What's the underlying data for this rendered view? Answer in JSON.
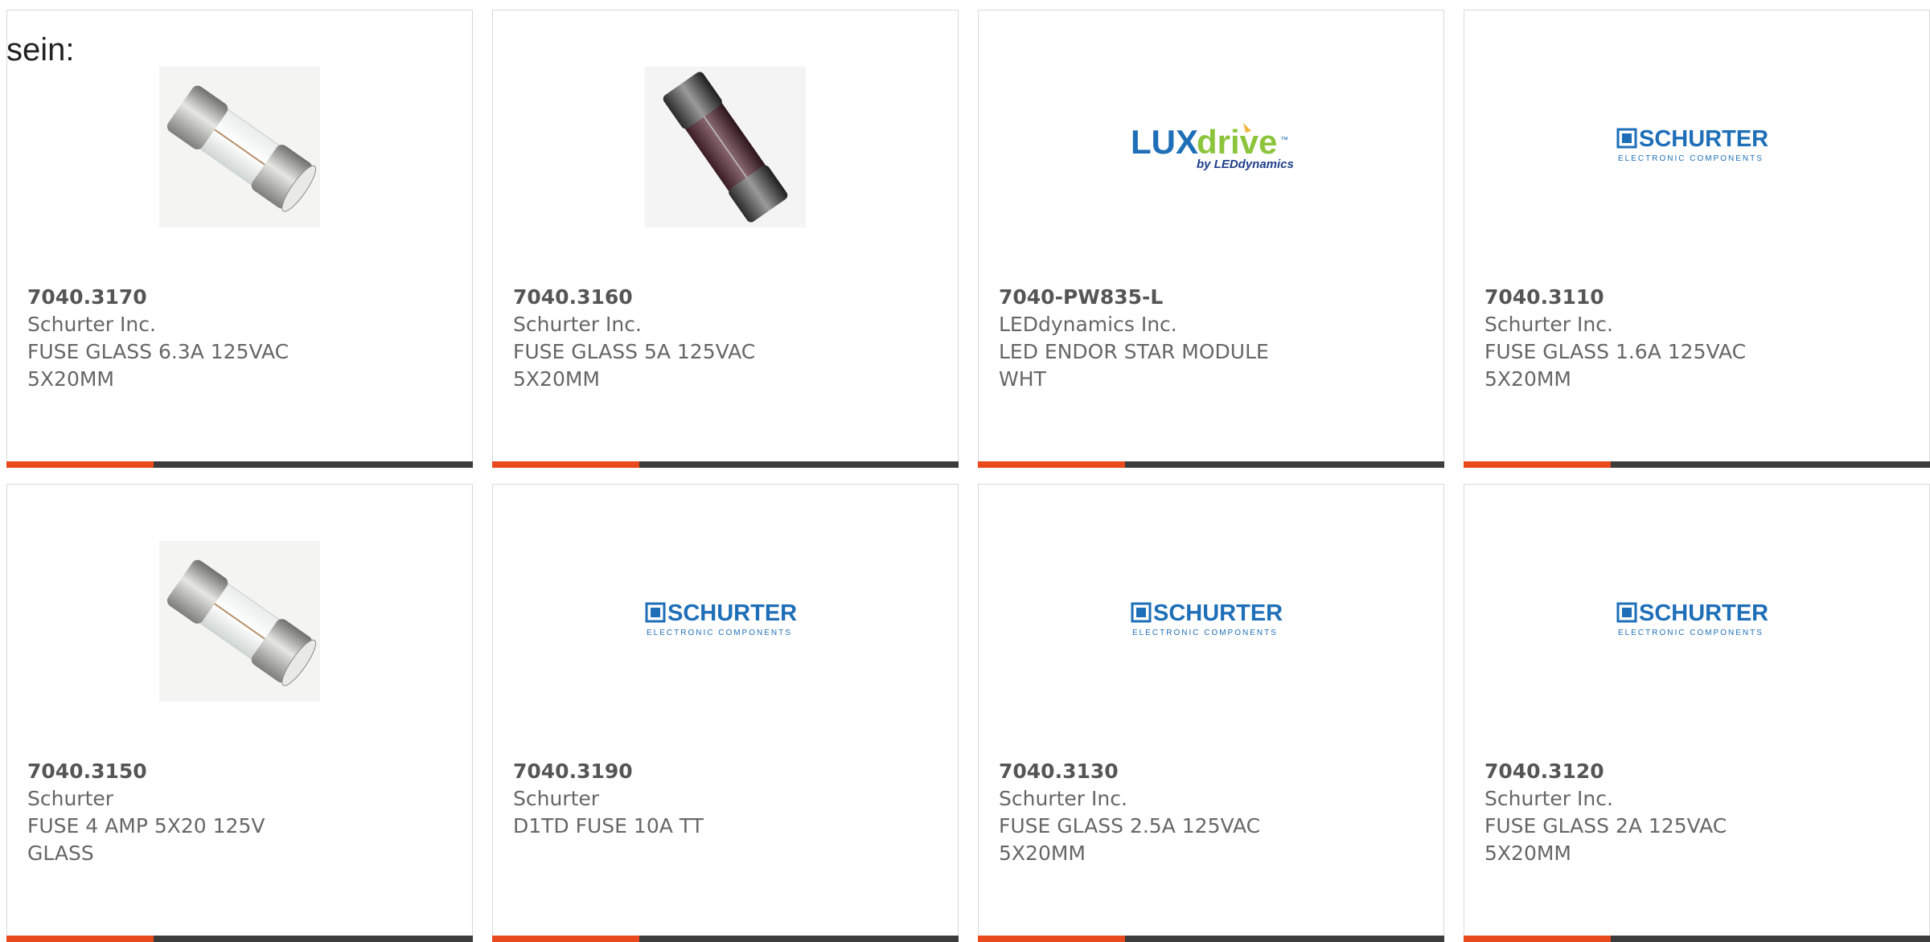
{
  "intro_text": "sein:",
  "colors": {
    "accent_orange": "#e8491d",
    "accent_dark": "#3c3c3c",
    "brand_blue": "#1e6fb8",
    "lux_green": "#8cc43c"
  },
  "products": [
    {
      "part": "7040.3170",
      "manufacturer": "Schurter Inc.",
      "description": "FUSE GLASS 6.3A 125VAC 5X20MM",
      "image": "fuse-photo-icon"
    },
    {
      "part": "7040.3160",
      "manufacturer": "Schurter Inc.",
      "description": "FUSE GLASS 5A 125VAC 5X20MM",
      "image": "dark-fuse-photo-icon"
    },
    {
      "part": "7040-PW835-L",
      "manufacturer": "LEDdynamics Inc.",
      "description": "LED ENDOR STAR MODULE WHT",
      "image": "luxdrive-logo",
      "logo_text": {
        "lux": "LUX",
        "drive": "drive",
        "tm": "™",
        "by": "by LEDdynamics"
      }
    },
    {
      "part": "7040.3110",
      "manufacturer": "Schurter Inc.",
      "description": "FUSE GLASS 1.6A 125VAC 5X20MM",
      "image": "schurter-logo",
      "logo_text": {
        "name": "SCHURTER",
        "sub": "ELECTRONIC COMPONENTS"
      }
    },
    {
      "part": "7040.3150",
      "manufacturer": "Schurter",
      "description": "FUSE 4 AMP 5X20 125V GLASS",
      "image": "fuse-photo-icon"
    },
    {
      "part": "7040.3190",
      "manufacturer": "Schurter",
      "description": "D1TD FUSE 10A TT",
      "image": "schurter-logo",
      "logo_text": {
        "name": "SCHURTER",
        "sub": "ELECTRONIC COMPONENTS"
      }
    },
    {
      "part": "7040.3130",
      "manufacturer": "Schurter Inc.",
      "description": "FUSE GLASS 2.5A 125VAC 5X20MM",
      "image": "schurter-logo",
      "logo_text": {
        "name": "SCHURTER",
        "sub": "ELECTRONIC COMPONENTS"
      }
    },
    {
      "part": "7040.3120",
      "manufacturer": "Schurter Inc.",
      "description": "FUSE GLASS 2A 125VAC 5X20MM",
      "image": "schurter-logo",
      "logo_text": {
        "name": "SCHURTER",
        "sub": "ELECTRONIC COMPONENTS"
      }
    }
  ]
}
